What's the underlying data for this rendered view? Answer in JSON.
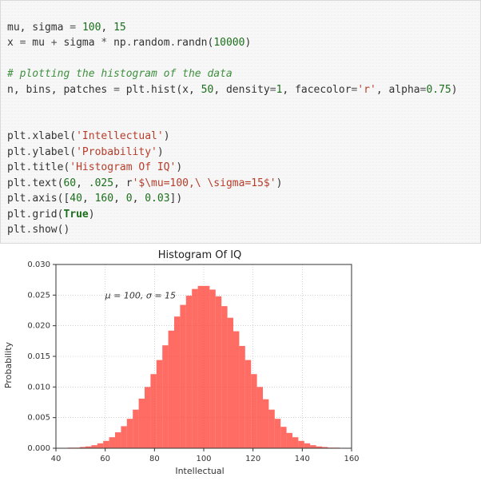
{
  "code": {
    "l1a": "mu, sigma ",
    "l1eq": "=",
    "l1b": " ",
    "l1n1": "100",
    "l1c": ", ",
    "l1n2": "15",
    "l2a": "x ",
    "l2eq": "=",
    "l2b": " mu ",
    "l2plus": "+",
    "l2c": " sigma ",
    "l2star": "*",
    "l2d": " np",
    "l2dot1": ".",
    "l2e": "random",
    "l2dot2": ".",
    "l2f": "randn(",
    "l2n": "10000",
    "l2g": ")",
    "l3": "# plotting the histogram of the data",
    "l4a": "n, bins, patches ",
    "l4eq": "=",
    "l4b": " plt",
    "l4dot": ".",
    "l4c": "hist(x, ",
    "l4n1": "50",
    "l4d": ", density",
    "l4eq2": "=",
    "l4n2": "1",
    "l4e": ", facecolor",
    "l4eq3": "=",
    "l4s": "'r'",
    "l4f": ", alpha",
    "l4eq4": "=",
    "l4n3": "0.75",
    "l4g": ")",
    "l5a": "plt",
    "l5dot": ".",
    "l5b": "xlabel(",
    "l5s": "'Intellectual'",
    "l5c": ")",
    "l6a": "plt",
    "l6dot": ".",
    "l6b": "ylabel(",
    "l6s": "'Probability'",
    "l6c": ")",
    "l7a": "plt",
    "l7dot": ".",
    "l7b": "title(",
    "l7s": "'Histogram Of IQ'",
    "l7c": ")",
    "l8a": "plt",
    "l8dot": ".",
    "l8b": "text(",
    "l8n1": "60",
    "l8c": ", ",
    "l8n2": ".025",
    "l8d": ", r",
    "l8s": "'$\\mu=100,\\ \\sigma=15$'",
    "l8e": ")",
    "l9a": "plt",
    "l9dot": ".",
    "l9b": "axis([",
    "l9n1": "40",
    "l9c": ", ",
    "l9n2": "160",
    "l9d": ", ",
    "l9n3": "0",
    "l9e": ", ",
    "l9n4": "0.03",
    "l9f": "])",
    "l10a": "plt",
    "l10dot": ".",
    "l10b": "grid(",
    "l10k": "True",
    "l10c": ")",
    "l11a": "plt",
    "l11dot": ".",
    "l11b": "show()"
  },
  "chart_data": {
    "type": "bar",
    "title": "Histogram Of IQ",
    "xlabel": "Intellectual",
    "ylabel": "Probability",
    "xlim": [
      40,
      160
    ],
    "ylim": [
      0,
      0.03
    ],
    "xticks": [
      40,
      60,
      80,
      100,
      120,
      140,
      160
    ],
    "yticks": [
      0.0,
      0.005,
      0.01,
      0.015,
      0.02,
      0.025,
      0.03
    ],
    "annotation": {
      "text": "μ = 100,  σ = 15",
      "x": 60,
      "y": 0.025
    },
    "facecolor": "#ff3b30",
    "alpha": 0.75,
    "grid": true,
    "bin_edges": [
      40.0,
      42.4,
      44.8,
      47.2,
      49.6,
      52.0,
      54.4,
      56.8,
      59.2,
      61.6,
      64.0,
      66.4,
      68.8,
      71.2,
      73.6,
      76.0,
      78.4,
      80.8,
      83.2,
      85.6,
      88.0,
      90.4,
      92.8,
      95.2,
      97.6,
      100.0,
      102.4,
      104.8,
      107.2,
      109.6,
      112.0,
      114.4,
      116.8,
      119.2,
      121.6,
      124.0,
      126.4,
      128.8,
      131.2,
      133.6,
      136.0,
      138.4,
      140.8,
      143.2,
      145.6,
      148.0,
      150.4,
      152.8,
      155.2,
      157.6,
      160.0
    ],
    "values": [
      0.0,
      0.0,
      0.0001,
      0.0001,
      0.0002,
      0.0003,
      0.0005,
      0.0008,
      0.0012,
      0.0018,
      0.0026,
      0.0036,
      0.0048,
      0.0063,
      0.0081,
      0.01,
      0.0121,
      0.0144,
      0.0168,
      0.0192,
      0.0215,
      0.0234,
      0.0249,
      0.026,
      0.0265,
      0.0265,
      0.0259,
      0.0248,
      0.0232,
      0.0213,
      0.0191,
      0.0167,
      0.0144,
      0.0121,
      0.01,
      0.008,
      0.0063,
      0.0048,
      0.0035,
      0.0025,
      0.0018,
      0.0012,
      0.0008,
      0.0005,
      0.0003,
      0.0002,
      0.0001,
      0.0001,
      0.0,
      0.0
    ]
  }
}
